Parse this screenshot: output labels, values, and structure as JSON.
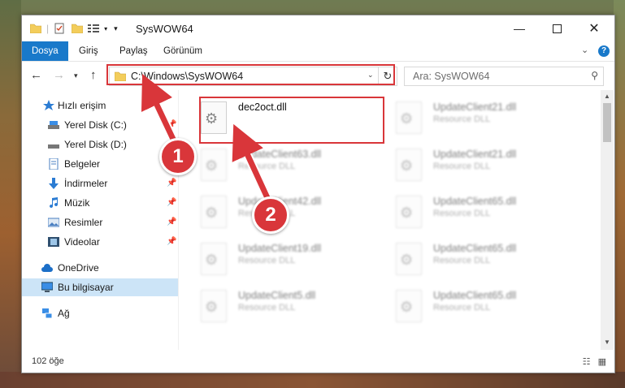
{
  "window": {
    "title": "SysWOW64"
  },
  "ribbon": {
    "tabs": [
      {
        "label": "Dosya",
        "active": true
      },
      {
        "label": "Giriş"
      },
      {
        "label": "Paylaş"
      },
      {
        "label": "Görünüm"
      }
    ],
    "help": "?"
  },
  "nav": {
    "address": "C:\\Windows\\SysWOW64",
    "search_placeholder": "Ara: SysWOW64"
  },
  "sidebar": {
    "items": [
      {
        "label": "Hızlı erişim",
        "icon": "star-icon"
      },
      {
        "label": "Yerel Disk (C:)",
        "icon": "drive-icon",
        "pinned": true
      },
      {
        "label": "Yerel Disk (D:)",
        "icon": "drive-icon",
        "pinned": true
      },
      {
        "label": "Belgeler",
        "icon": "documents-icon",
        "pinned": true
      },
      {
        "label": "İndirmeler",
        "icon": "download-icon",
        "pinned": true
      },
      {
        "label": "Müzik",
        "icon": "music-icon",
        "pinned": true
      },
      {
        "label": "Resimler",
        "icon": "pictures-icon",
        "pinned": true
      },
      {
        "label": "Videolar",
        "icon": "video-icon",
        "pinned": true
      },
      {
        "label": "OneDrive",
        "icon": "cloud-icon"
      },
      {
        "label": "Bu bilgisayar",
        "icon": "computer-icon",
        "selected": true
      },
      {
        "label": "Ağ",
        "icon": "network-icon"
      }
    ]
  },
  "files": {
    "highlighted": {
      "name": "dec2oct.dll"
    },
    "blurred": [
      {
        "name": "UpdateClient63.dll",
        "type": "Resource DLL"
      },
      {
        "name": "UpdateClient42.dll",
        "type": "Resource DLL"
      },
      {
        "name": "UpdateClient19.dll",
        "type": "Resource DLL"
      },
      {
        "name": "UpdateClient5.dll",
        "type": "Resource DLL"
      },
      {
        "name": "UpdateClient21.dll",
        "type": "Resource DLL"
      },
      {
        "name": "UpdateClient21.dll",
        "type": "Resource DLL"
      },
      {
        "name": "UpdateClient65.dll",
        "type": "Resource DLL"
      },
      {
        "name": "UpdateClient65.dll",
        "type": "Resource DLL"
      },
      {
        "name": "UpdateClient65.dll",
        "type": "Resource DLL"
      }
    ]
  },
  "status": {
    "count": "102 öğe"
  },
  "annotations": {
    "step1": "1",
    "step2": "2"
  },
  "colors": {
    "accent": "#1979ca",
    "highlight": "#d9363a",
    "selection": "#cce4f7"
  }
}
